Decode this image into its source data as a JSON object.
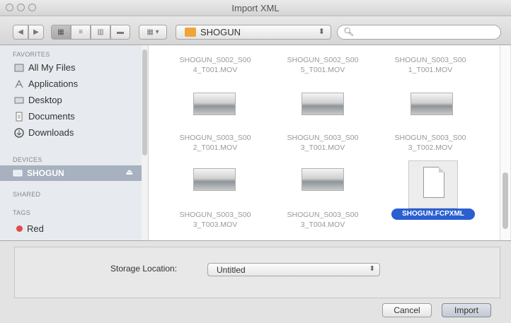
{
  "window": {
    "title": "Import XML"
  },
  "toolbar": {
    "path_label": "SHOGUN",
    "search_placeholder": ""
  },
  "sidebar": {
    "favorites_header": "FAVORITES",
    "favorites": [
      {
        "label": "All My Files",
        "icon": "all-files-icon"
      },
      {
        "label": "Applications",
        "icon": "applications-icon"
      },
      {
        "label": "Desktop",
        "icon": "desktop-icon"
      },
      {
        "label": "Documents",
        "icon": "documents-icon"
      },
      {
        "label": "Downloads",
        "icon": "downloads-icon"
      }
    ],
    "devices_header": "DEVICES",
    "device_selected": "SHOGUN",
    "shared_header": "SHARED",
    "tags_header": "TAGS",
    "tags": [
      {
        "label": "Red",
        "color": "#e04b4b"
      }
    ]
  },
  "files": [
    {
      "name_line1": "SHOGUN_S002_S00",
      "name_line2": "4_T001.MOV"
    },
    {
      "name_line1": "SHOGUN_S002_S00",
      "name_line2": "5_T001.MOV"
    },
    {
      "name_line1": "SHOGUN_S003_S00",
      "name_line2": "1_T001.MOV"
    },
    {
      "name_line1": "SHOGUN_S003_S00",
      "name_line2": "2_T001.MOV"
    },
    {
      "name_line1": "SHOGUN_S003_S00",
      "name_line2": "3_T001.MOV"
    },
    {
      "name_line1": "SHOGUN_S003_S00",
      "name_line2": "3_T002.MOV"
    },
    {
      "name_line1": "SHOGUN_S003_S00",
      "name_line2": "3_T003.MOV"
    },
    {
      "name_line1": "SHOGUN_S003_S00",
      "name_line2": "3_T004.MOV"
    }
  ],
  "selected_file": "SHOGUN.FCPXML",
  "storage": {
    "label": "Storage Location:",
    "value": "Untitled"
  },
  "buttons": {
    "cancel": "Cancel",
    "import": "Import"
  },
  "colors": {
    "selection": "#2a5fd1",
    "sidebar_selection": "#a7b1bf",
    "tag_red": "#e04b4b"
  }
}
